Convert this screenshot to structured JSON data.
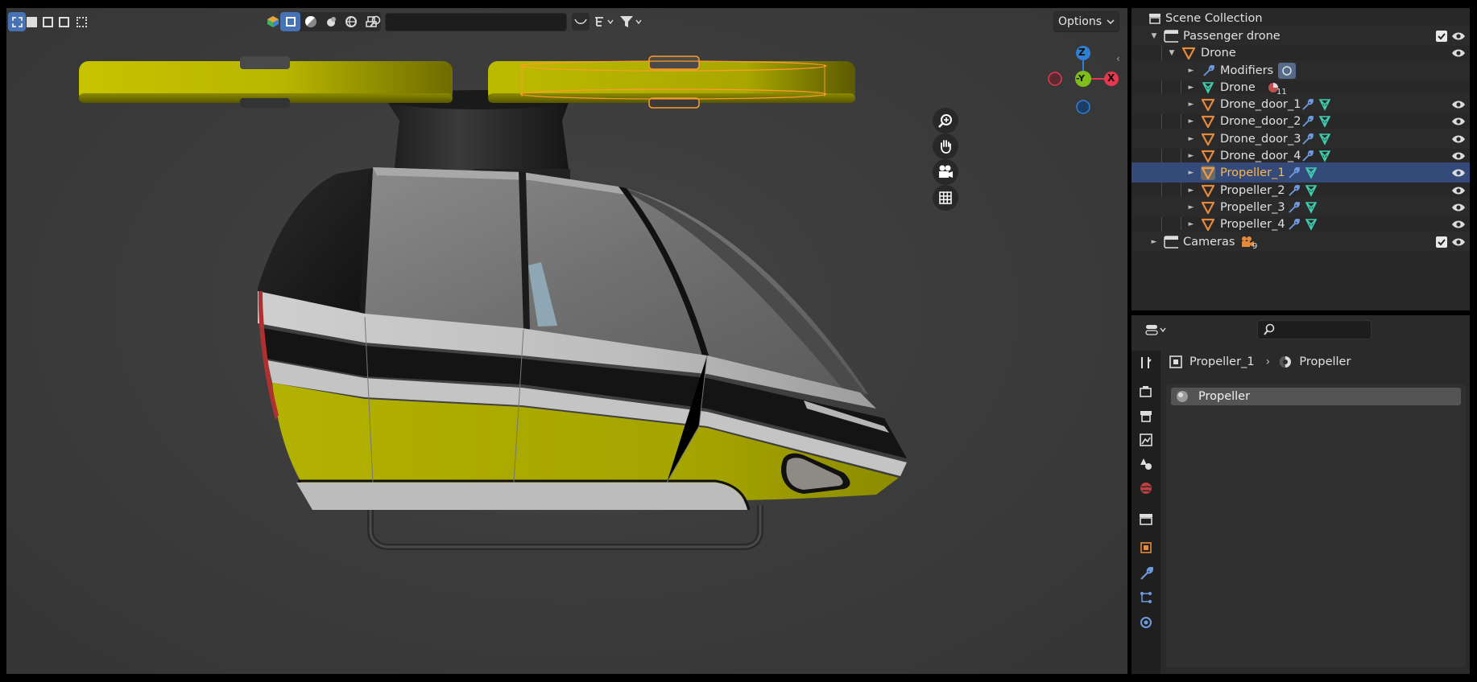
{
  "viewport": {
    "options_label": "Options",
    "gizmo": {
      "z": "Z",
      "neg_y": "-Y",
      "x": "X"
    },
    "colors": {
      "accent": "#4772b3",
      "body_yellow": "#a9a800",
      "propeller_yellow": "#b9b700",
      "selection_orange": "#ff9c2b",
      "axis_x": "#e5384f",
      "axis_y": "#7fbd1c",
      "axis_z": "#2f7fd4"
    }
  },
  "outliner": {
    "scene_collection": "Scene Collection",
    "rows": [
      {
        "label": "Passenger drone",
        "icon": "collection-icon",
        "checked": true,
        "visible": true
      },
      {
        "label": "Drone",
        "icon": "mesh-object-icon",
        "visible": true
      },
      {
        "label": "Modifiers",
        "icon": "wrench-icon"
      },
      {
        "label": "Drone",
        "icon": "mesh-data-icon",
        "badge": "11"
      },
      {
        "label": "Drone_door_1",
        "icon": "mesh-object-icon",
        "visible": true
      },
      {
        "label": "Drone_door_2",
        "icon": "mesh-object-icon",
        "visible": true
      },
      {
        "label": "Drone_door_3",
        "icon": "mesh-object-icon",
        "visible": true
      },
      {
        "label": "Drone_door_4",
        "icon": "mesh-object-icon",
        "visible": true
      },
      {
        "label": "Propeller_1",
        "icon": "mesh-object-icon",
        "visible": true,
        "selected": true
      },
      {
        "label": "Propeller_2",
        "icon": "mesh-object-icon",
        "visible": true
      },
      {
        "label": "Propeller_3",
        "icon": "mesh-object-icon",
        "visible": true
      },
      {
        "label": "Propeller_4",
        "icon": "mesh-object-icon",
        "visible": true
      },
      {
        "label": "Cameras",
        "icon": "collection-icon",
        "badge": "9",
        "checked": true,
        "visible": true
      }
    ]
  },
  "properties": {
    "breadcrumb_object": "Propeller_1",
    "breadcrumb_material": "Propeller",
    "material_slot": "Propeller",
    "tabs": [
      "tool-icon",
      "render-icon",
      "output-icon",
      "view-layer-icon",
      "scene-icon",
      "world-icon",
      "collection-icon",
      "object-icon",
      "modifier-icon",
      "particles-icon",
      "physics-icon"
    ]
  }
}
